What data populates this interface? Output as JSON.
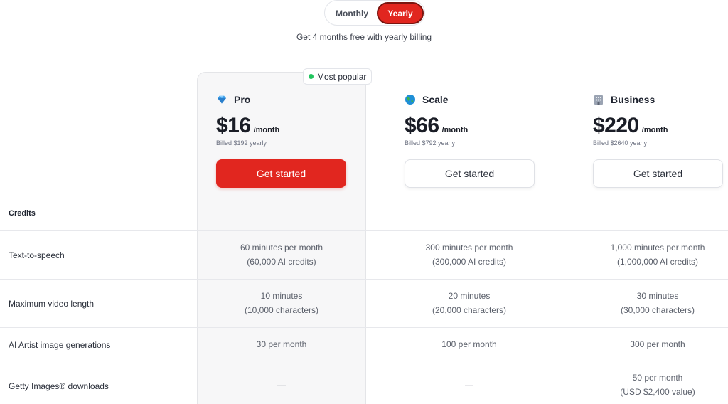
{
  "billing_toggle": {
    "monthly_label": "Monthly",
    "yearly_label": "Yearly",
    "selected": "Yearly"
  },
  "billing_note": "Get 4 months free with yearly billing",
  "badge": {
    "label": "Most popular"
  },
  "plans": [
    {
      "name": "Pro",
      "icon": "diamond-icon",
      "price": "$16",
      "period": "/month",
      "billed": "Billed $192 yearly",
      "cta": "Get started",
      "highlighted": true
    },
    {
      "name": "Scale",
      "icon": "globe-icon",
      "price": "$66",
      "period": "/month",
      "billed": "Billed $792 yearly",
      "cta": "Get started",
      "highlighted": false
    },
    {
      "name": "Business",
      "icon": "building-icon",
      "price": "$220",
      "period": "/month",
      "billed": "Billed $2640 yearly",
      "cta": "Get started",
      "highlighted": false
    }
  ],
  "section_label": "Credits",
  "rows": [
    {
      "label": "Text-to-speech",
      "values": [
        {
          "line1": "60 minutes per month",
          "line2": "(60,000 AI credits)"
        },
        {
          "line1": "300 minutes per month",
          "line2": "(300,000 AI credits)"
        },
        {
          "line1": "1,000 minutes per month",
          "line2": "(1,000,000 AI credits)"
        }
      ]
    },
    {
      "label": "Maximum video length",
      "values": [
        {
          "line1": "10 minutes",
          "line2": "(10,000 characters)"
        },
        {
          "line1": "20 minutes",
          "line2": "(20,000 characters)"
        },
        {
          "line1": "30 minutes",
          "line2": "(30,000 characters)"
        }
      ]
    },
    {
      "label": "AI Artist image generations",
      "values": [
        {
          "line1": "30 per month",
          "line2": ""
        },
        {
          "line1": "100 per month",
          "line2": ""
        },
        {
          "line1": "300 per month",
          "line2": ""
        }
      ]
    },
    {
      "label": "Getty Images® downloads",
      "values": [
        {
          "line1": "—",
          "line2": ""
        },
        {
          "line1": "—",
          "line2": ""
        },
        {
          "line1": "50 per month",
          "line2": "(USD $2,400 value)"
        }
      ]
    }
  ],
  "colors": {
    "accent": "#e1261f",
    "popular_dot": "#22c55e"
  }
}
